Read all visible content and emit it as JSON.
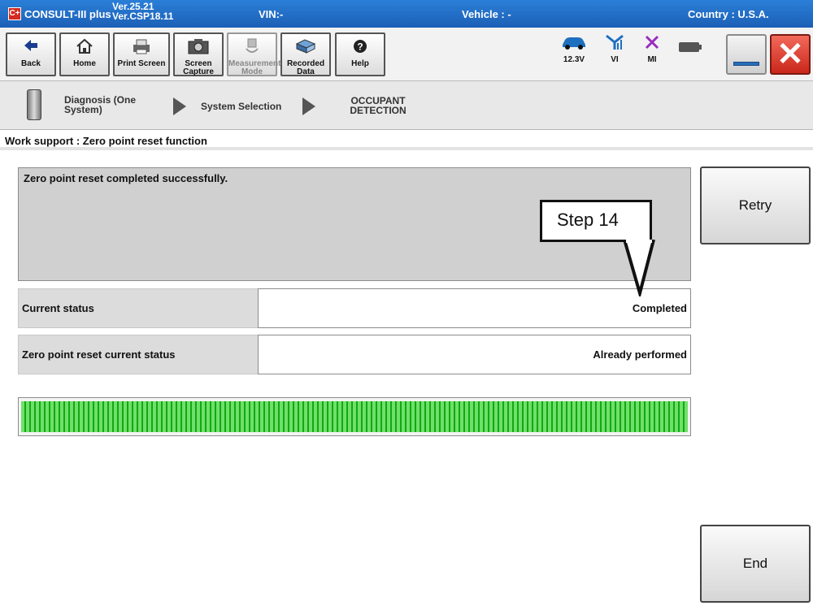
{
  "titlebar": {
    "logo": "C+",
    "app_name": "CONSULT-III plus",
    "version_line1": "Ver.25.21",
    "version_line2": "Ver.CSP18.11",
    "vin": "VIN:-",
    "vehicle": "Vehicle : -",
    "country": "Country : U.S.A."
  },
  "toolbar": {
    "buttons": [
      {
        "label": "Back",
        "icon": "back-arrow-icon"
      },
      {
        "label": "Home",
        "icon": "home-icon"
      },
      {
        "label": "Print Screen",
        "icon": "printer-icon"
      },
      {
        "label": "Screen Capture",
        "icon": "camera-icon"
      },
      {
        "label": "Measurement Mode",
        "icon": "measurement-icon",
        "disabled": true
      },
      {
        "label": "Recorded Data",
        "icon": "recorded-data-icon"
      },
      {
        "label": "Help",
        "icon": "help-icon"
      }
    ],
    "status": {
      "voltage": "12.3V",
      "vi": "VI",
      "mi": "MI"
    }
  },
  "breadcrumb": {
    "items": [
      "Diagnosis (One System)",
      "System Selection",
      "OCCUPANT DETECTION"
    ]
  },
  "section_title": "Work support : Zero point reset function",
  "message": "Zero point reset completed successfully.",
  "rows": [
    {
      "label": "Current status",
      "value": "Completed"
    },
    {
      "label": "Zero point reset current status",
      "value": "Already performed"
    }
  ],
  "progress": {
    "fraction": 1.0,
    "color": "#2fbf2f"
  },
  "buttons": {
    "retry": "Retry",
    "end": "End"
  },
  "callout": {
    "text": "Step 14"
  }
}
